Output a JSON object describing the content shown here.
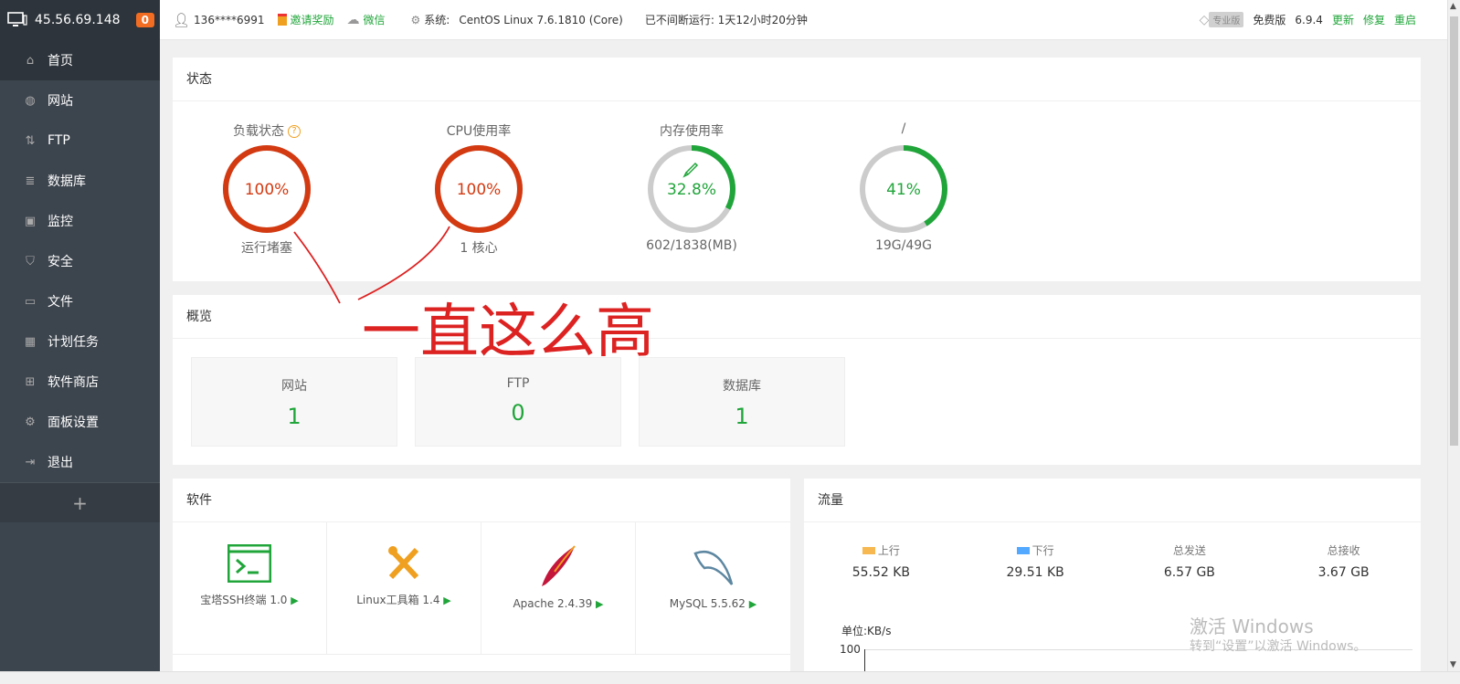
{
  "sidebar": {
    "ip": "45.56.69.148",
    "badge": "0",
    "items": [
      {
        "label": "首页",
        "icon": "home-icon"
      },
      {
        "label": "网站",
        "icon": "globe-icon"
      },
      {
        "label": "FTP",
        "icon": "ftp-icon"
      },
      {
        "label": "数据库",
        "icon": "database-icon"
      },
      {
        "label": "监控",
        "icon": "monitor-icon"
      },
      {
        "label": "安全",
        "icon": "shield-icon"
      },
      {
        "label": "文件",
        "icon": "folder-icon"
      },
      {
        "label": "计划任务",
        "icon": "calendar-icon"
      },
      {
        "label": "软件商店",
        "icon": "grid-icon"
      },
      {
        "label": "面板设置",
        "icon": "gear-icon"
      },
      {
        "label": "退出",
        "icon": "logout-icon"
      }
    ],
    "add": "+"
  },
  "topbar": {
    "user": "136****6991",
    "invite": "邀请奖励",
    "wechat": "微信",
    "system_label": "系统:",
    "system_value": "CentOS Linux 7.6.1810 (Core)",
    "uptime": "已不间断运行: 1天12小时20分钟",
    "pro": "专业版",
    "edition": "免费版",
    "version": "6.9.4",
    "update": "更新",
    "repair": "修复",
    "restart": "重启"
  },
  "status": {
    "title": "状态",
    "gauges": [
      {
        "title": "负载状态",
        "value": "100%",
        "sub": "运行堵塞",
        "percent": 100,
        "color": "#d33a12"
      },
      {
        "title": "CPU使用率",
        "value": "100%",
        "sub": "1 核心",
        "percent": 100,
        "color": "#d33a12"
      },
      {
        "title": "内存使用率",
        "value": "32.8%",
        "sub": "602/1838(MB)",
        "percent": 32.8,
        "color": "#20a53a"
      },
      {
        "title": "/",
        "value": "41%",
        "sub": "19G/49G",
        "percent": 41,
        "color": "#20a53a"
      }
    ]
  },
  "overview": {
    "title": "概览",
    "boxes": [
      {
        "label": "网站",
        "value": "1"
      },
      {
        "label": "FTP",
        "value": "0"
      },
      {
        "label": "数据库",
        "value": "1"
      }
    ]
  },
  "software": {
    "title": "软件",
    "items": [
      {
        "name": "宝塔SSH终端 1.0",
        "icon": "terminal-icon"
      },
      {
        "name": "Linux工具箱 1.4",
        "icon": "toolbox-icon"
      },
      {
        "name": "Apache 2.4.39",
        "icon": "apache-feather-icon"
      },
      {
        "name": "MySQL 5.5.62",
        "icon": "mysql-dolphin-icon"
      }
    ]
  },
  "traffic": {
    "title": "流量",
    "stats": [
      {
        "label": "上行",
        "value": "55.52 KB",
        "swatch": "#f7b851"
      },
      {
        "label": "下行",
        "value": "29.51 KB",
        "swatch": "#52a9ff"
      },
      {
        "label": "总发送",
        "value": "6.57 GB"
      },
      {
        "label": "总接收",
        "value": "3.67 GB"
      }
    ],
    "unit": "单位:KB/s",
    "axis_max": "100"
  },
  "handwriting": "一直这么高",
  "watermark": {
    "line1": "激活 Windows",
    "line2": "转到“设置”以激活 Windows。"
  }
}
